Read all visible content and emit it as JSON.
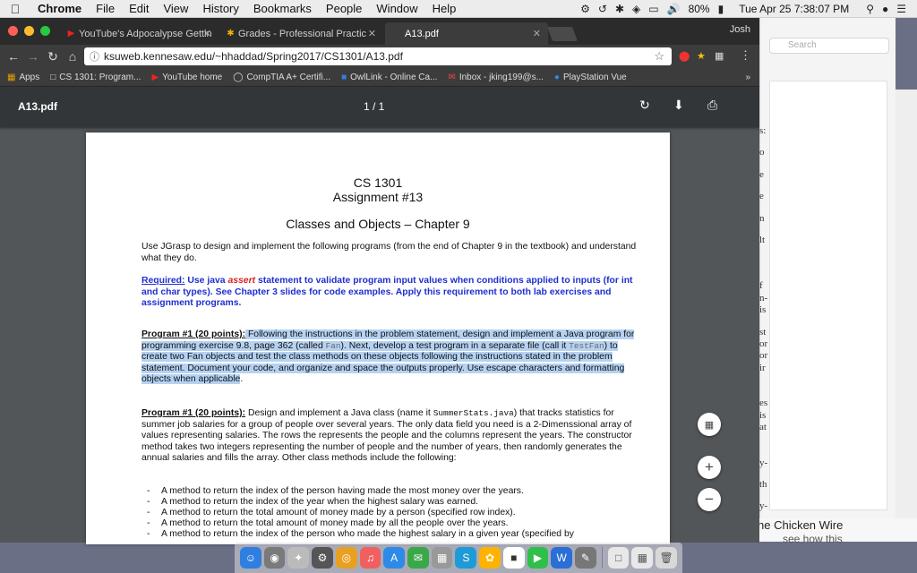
{
  "menubar": {
    "app": "Chrome",
    "menus": [
      "File",
      "Edit",
      "View",
      "History",
      "Bookmarks",
      "People",
      "Window",
      "Help"
    ],
    "battery": "80%",
    "clock": "Tue Apr 25  7:38:07 PM"
  },
  "tabs": [
    {
      "label": "YouTube's Adpocalypse Gettin",
      "icon": "youtube-icon"
    },
    {
      "label": "Grades - Professional Practic",
      "icon": "grades-icon"
    },
    {
      "label": "A13.pdf",
      "icon": "pdf-icon"
    }
  ],
  "profile": "Josh",
  "address": {
    "url": "ksuweb.kennesaw.edu/~hhaddad/Spring2017/CS1301/A13.pdf"
  },
  "bookmarks": [
    {
      "label": "Apps",
      "icon": "apps-icon"
    },
    {
      "label": "CS 1301: Program...",
      "icon": "page-icon"
    },
    {
      "label": "YouTube home",
      "icon": "youtube-icon"
    },
    {
      "label": "CompTIA A+ Certifi...",
      "icon": "comptia-icon"
    },
    {
      "label": "OwlLink - Online Ca...",
      "icon": "owllink-icon"
    },
    {
      "label": "Inbox - jking199@s...",
      "icon": "gmail-icon"
    },
    {
      "label": "PlayStation Vue",
      "icon": "playstation-icon"
    }
  ],
  "bookmarks_more": "»",
  "pdf_viewer": {
    "filename": "A13.pdf",
    "page_indicator": "1  /  1"
  },
  "document": {
    "course": "CS 1301",
    "assignment": "Assignment #13",
    "chapter": "Classes and Objects – Chapter 9",
    "intro": "Use JGrasp to design and implement the following programs (from the end of Chapter 9 in the textbook) and understand what they do.",
    "required": {
      "label": "Required:",
      "text_before": " Use java ",
      "assert_word": "assert",
      "text_after": " statement to validate program input values when conditions applied to inputs (for int and char types). See Chapter 3 slides for code examples. Apply this requirement to both lab exercises and assignment programs."
    },
    "program1": {
      "label": "Program #1 (20 points):",
      "p1": " Following the instructions in the problem statement, design and implement a Java program for programming exercise 9.8, page 362 (called ",
      "code1": "Fan",
      "p2": "). Next, develop a test program in a separate file (call it ",
      "code2": "TestFan",
      "p3": ") to create two Fan objects and test the class methods on these objects following the instructions stated in the problem statement. Document your code, and organize and space the outputs properly. Use escape characters and formatting objects when applicable",
      "p4": "."
    },
    "program2": {
      "label": "Program #1 (20 points):",
      "p1": " Design and implement a Java class (name it ",
      "code": "SummerStats.java",
      "p2": ") that tracks statistics for summer job salaries for a group of people over several years. The only data field you need is a 2-Dimenssional array of values representing salaries. The rows the represents the people and the columns represent the years.  The constructor method takes two integers representing the number of people and the number of years, then randomly generates the annual salaries and fills the array. Other class methods include the following:"
    },
    "bullets": [
      "A method to return the index of the person having made the most money over the years.",
      "A method to return the index of the year when the highest salary was earned.",
      "A method to return the total amount of money made by a person (specified row index).",
      "A method to return the total amount of money made by all the people over the years.",
      "A method to return the index of the person who made the highest salary in a given year (specified by"
    ]
  },
  "background_window": {
    "search_placeholder": "Search",
    "caption": "he Chicken Wire",
    "caption_sub": "see how this",
    "peek_letters": [
      "s:",
      "o",
      "e",
      "e",
      "n",
      "lt",
      "",
      "f",
      "n-",
      "is",
      "",
      "st",
      "or",
      "or",
      "ir",
      "",
      "",
      "es",
      "is",
      "at",
      "",
      "",
      "y-",
      "th",
      "",
      "y-"
    ]
  }
}
